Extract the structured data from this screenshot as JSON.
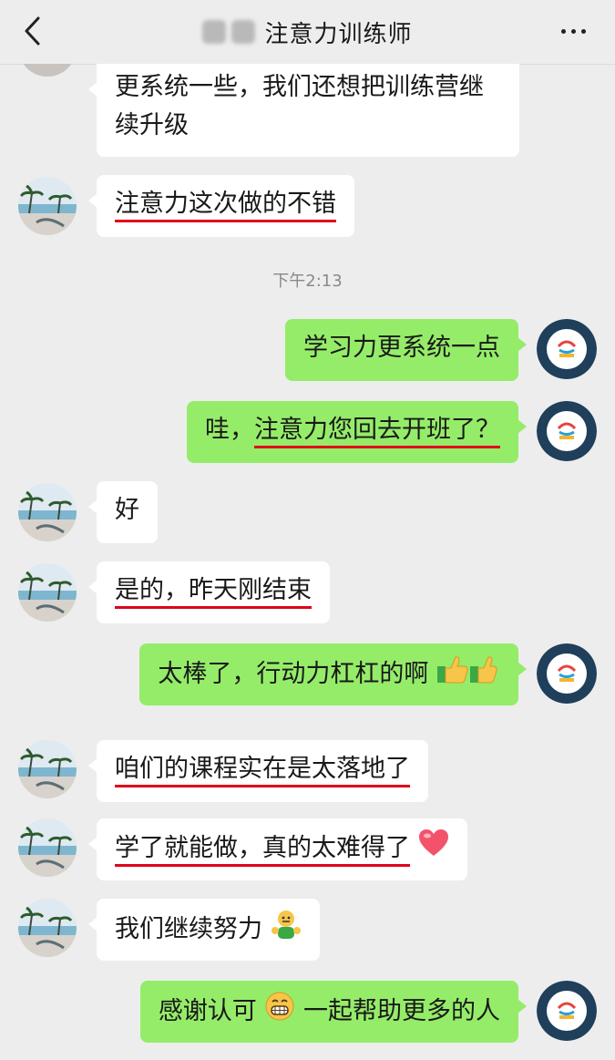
{
  "header": {
    "title": "注意力训练师",
    "back_icon": "chevron-left-icon",
    "more_icon": "more-dots-icon"
  },
  "messages": [
    {
      "side": "left",
      "text": "更系统一些，我们还想把训练营继续升级",
      "line1": "更系统一些，我们还想把训练营继",
      "line2": "续升级"
    },
    {
      "side": "left",
      "text": "注意力这次做的不错"
    },
    {
      "time": "下午2:13"
    },
    {
      "side": "right",
      "text": "学习力更系统一点"
    },
    {
      "side": "right",
      "prefix": "哇，",
      "text": "注意力您回去开班了？"
    },
    {
      "side": "left",
      "text": "好"
    },
    {
      "side": "left",
      "text": "是的，昨天刚结束"
    },
    {
      "side": "right",
      "text": "太棒了，行动力杠杠的啊",
      "emoji": "thumbs-up-icon"
    },
    {
      "side": "left",
      "text": "咱们的课程实在是太落地了"
    },
    {
      "side": "left",
      "text": "学了就能做，真的太难得了",
      "emoji": "heart-icon"
    },
    {
      "side": "left",
      "text": "我们继续努力",
      "emoji": "strong-person-icon"
    },
    {
      "side": "right",
      "text_a": "感谢认可",
      "text_b": "一起帮助更多的人",
      "emoji": "grin-face-icon"
    }
  ],
  "colors": {
    "self_bubble": "#95ec69",
    "other_bubble": "#ffffff",
    "underline": "#e0001b",
    "background": "#ededed"
  }
}
